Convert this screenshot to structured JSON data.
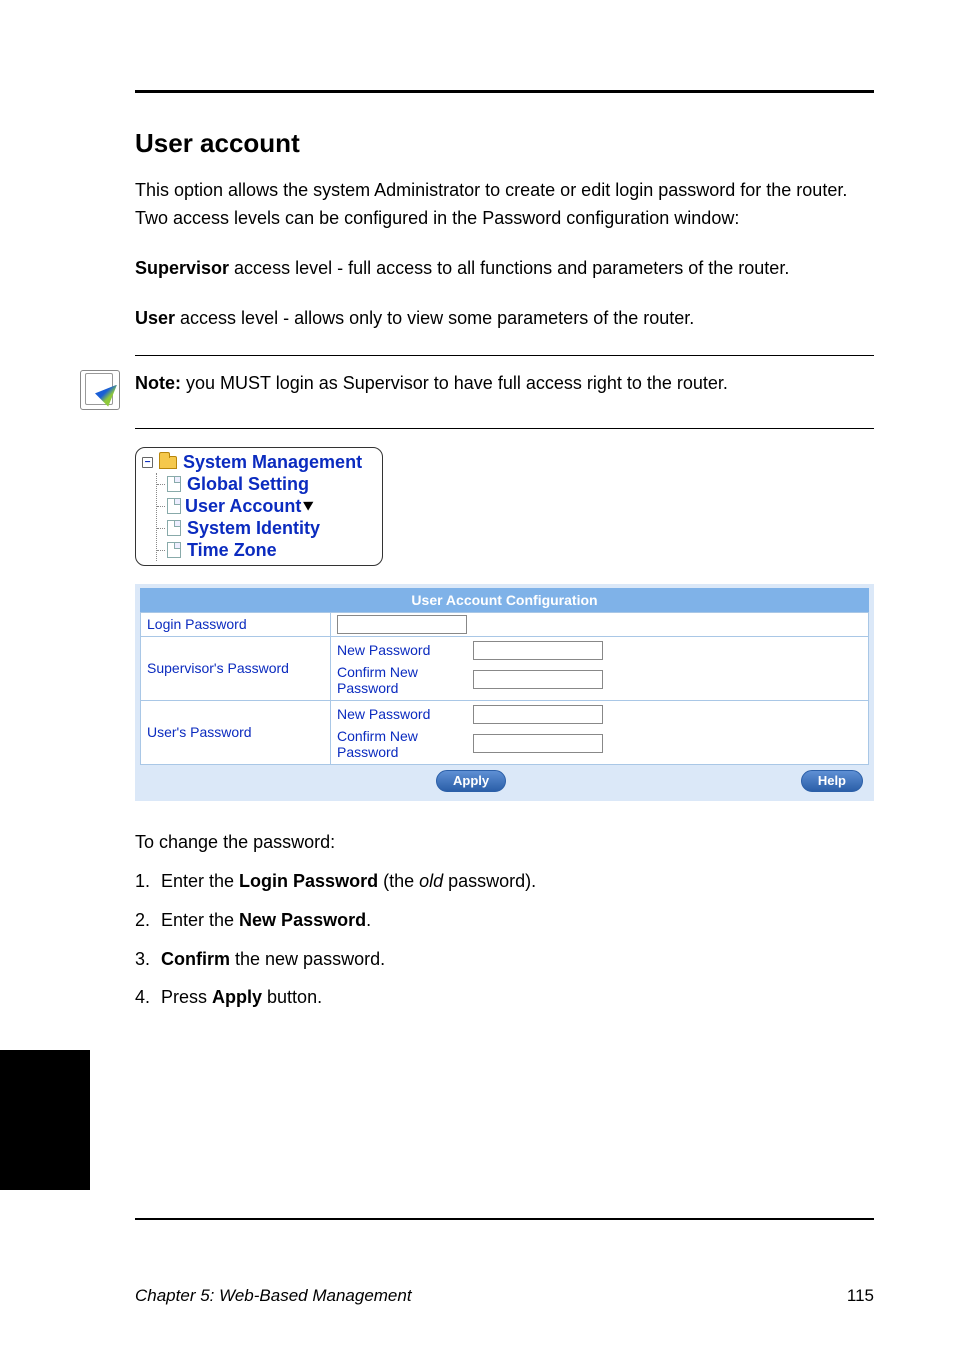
{
  "section_title": "User account",
  "intro_p1": "This option allows the system Administrator to create or edit login password for the router. Two access levels can be configured in the Password configuration window:",
  "intro_p2_a": "Supervisor",
  "intro_p2_b": " access level - full access to all functions and parameters of the router.",
  "intro_p3_a": "User",
  "intro_p3_b": " access level - allows only to view some parameters of the router.",
  "note_strong": "Note:",
  "note_text": " you MUST login as Supervisor to have full access right to the router.",
  "tree": {
    "root": "System Management",
    "items": [
      "Global Setting",
      "User Account",
      "System Identity",
      "Time Zone"
    ]
  },
  "config": {
    "title": "User Account Configuration",
    "login_label": "Login Password",
    "supervisor_label": "Supervisor's Password",
    "user_label": "User's Password",
    "new_pw": "New Password",
    "confirm_pw": "Confirm New Password",
    "apply": "Apply",
    "help": "Help"
  },
  "steps_intro": "To change the password:",
  "steps": [
    {
      "a": "Enter the ",
      "b": "Login Password",
      "c": " (the ",
      "d": "old",
      "e": " password)."
    },
    {
      "a": "Enter the ",
      "b": "New Password",
      "c": "."
    },
    {
      "a": "",
      "b": "Confirm",
      "c": " the new password."
    },
    {
      "a": "Press ",
      "b": "Apply",
      "c": " button."
    }
  ],
  "footer_left": "Chapter 5: Web-Based Management",
  "footer_right": "115"
}
